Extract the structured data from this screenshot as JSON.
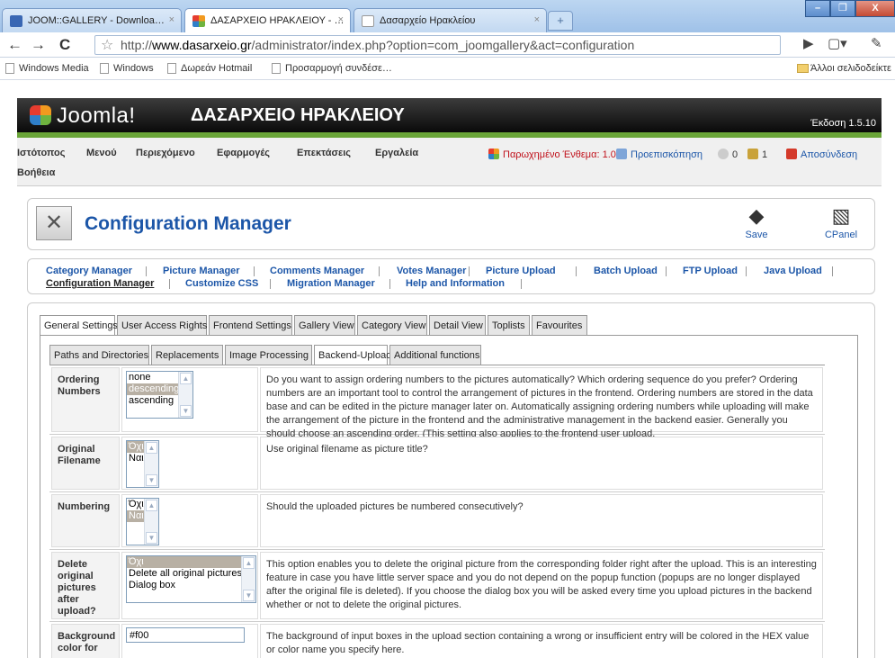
{
  "browser": {
    "tabs": [
      {
        "title": "JOOM::GALLERY - Downloa…",
        "favicon_color": "#3a67b3"
      },
      {
        "title": "ΔΑΣΑΡΧΕΙΟ ΗΡΑΚΛΕΙΟΥ - …",
        "favicon_color": "#1a1a1a"
      },
      {
        "title": "Δασαρχείο Ηρακλείου",
        "favicon_color": "#ffffff"
      }
    ],
    "close_glyph": "×",
    "new_tab_glyph": "+",
    "window_buttons": [
      "–",
      "❐",
      "X"
    ],
    "url_prefix": "http://",
    "url_host": "www.dasarxeio.gr",
    "url_path": "/administrator/index.php?option=com_joomgallery&act=configuration",
    "bookmarks": [
      "Windows Media",
      "Windows",
      "Δωρεάν Hotmail",
      "Προσαρμογή συνδέσε…"
    ],
    "other_bookmarks": "Άλλοι σελιδοδείκτε"
  },
  "header": {
    "logo_text": "Joomla!",
    "site_name": "ΔΑΣΑΡΧΕΙΟ ΗΡΑΚΛΕΙΟΥ",
    "version": "Έκδοση 1.5.10"
  },
  "menu": {
    "items": [
      "Ιστότοπος",
      "Μενού",
      "Περιεχόμενο",
      "Εφαρμογές",
      "Επεκτάσεις",
      "Εργαλεία"
    ],
    "help": "Βοήθεια",
    "status_cached": "Παρωχημένο Ένθεμα: 1.0",
    "status_preview": "Προεπισκόπηση",
    "count_messages": "0",
    "count_users": "1",
    "logout": "Αποσύνδεση"
  },
  "toolbar": {
    "title": "Configuration Manager",
    "save_label": "Save",
    "cpanel_label": "CPanel"
  },
  "submenu": {
    "row1": [
      "Category Manager",
      "Picture Manager",
      "Comments Manager",
      "Votes Manager",
      "Picture Upload",
      "Batch Upload",
      "FTP Upload",
      "Java Upload"
    ],
    "row2": [
      "Configuration Manager",
      "Customize CSS",
      "Migration Manager",
      "Help and Information"
    ]
  },
  "tabs": [
    "General Settings",
    "User Access Rights",
    "Frontend Settings",
    "Gallery View",
    "Category View",
    "Detail View",
    "Toplists",
    "Favourites"
  ],
  "subtabs": [
    "Paths and Directories",
    "Replacements",
    "Image Processing",
    "Backend-Upload",
    "Additional functions"
  ],
  "settings": [
    {
      "label": "Ordering Numbers",
      "options": [
        "none",
        "descending",
        "ascending"
      ],
      "selected": 1,
      "description": "Do you want to assign ordering numbers to the pictures automatically? Which ordering sequence do you prefer? Ordering numbers are an important tool to control the arrangement of pictures in the frontend. Ordering numbers are stored in the data base and can be edited in the picture manager later on. Automatically assigning ordering numbers while uploading will make the arrangement of the picture in the frontend and the administrative management in the backend easier. Generally you should choose an ascending order. (This setting also applies to the frontend user upload."
    },
    {
      "label": "Original Filename",
      "options": [
        "Όχι",
        "Ναι"
      ],
      "selected": 0,
      "description": "Use original filename as picture title?"
    },
    {
      "label": "Numbering",
      "options": [
        "Όχι",
        "Ναι"
      ],
      "selected": 1,
      "description": "Should the uploaded pictures be numbered consecutively?"
    },
    {
      "label": "Delete original pictures after upload?",
      "options": [
        "Όχι",
        "Delete all original pictures",
        "Dialog box"
      ],
      "selected": 0,
      "description": "This option enables you to delete the original picture from the corresponding folder right after the upload. This is an interesting feature in case you have little server space and you do not depend on the popup function (popups are no longer displayed after the original file is deleted). If you choose the dialog box you will be asked every time you upload pictures in the backend whether or not to delete the original pictures."
    },
    {
      "label": "Background color for",
      "value": "#f00",
      "description": "The background of input boxes in the upload section containing a wrong or insufficient entry will be colored in the HEX value or color name you specify here."
    }
  ]
}
